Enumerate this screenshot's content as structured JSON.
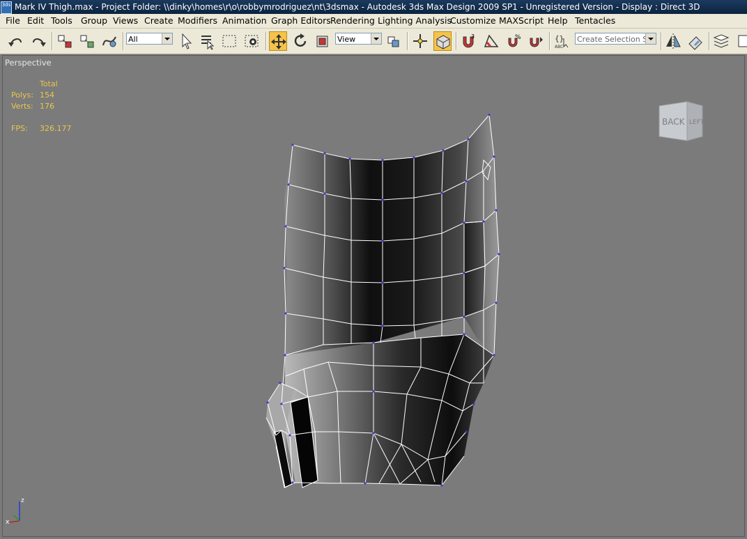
{
  "titlebar": {
    "icon_text": "3ds",
    "text": "Mark IV Thigh.max    - Project Folder: \\\\dinky\\homes\\r\\o\\robbymrodriguez\\nt\\3dsmax    - Autodesk 3ds Max Design 2009 SP1    - Unregistered Version    - Display : Direct 3D"
  },
  "menu": {
    "file": "File",
    "edit": "Edit",
    "tools": "Tools",
    "group": "Group",
    "views": "Views",
    "create": "Create",
    "modifiers": "Modifiers",
    "animation": "Animation",
    "graph_editors": "Graph Editors",
    "rendering": "Rendering",
    "lighting_analysis": "Lighting Analysis",
    "customize": "Customize",
    "maxscript": "MAXScript",
    "help": "Help",
    "tentacles": "Tentacles"
  },
  "toolbar": {
    "selection_filter": "All",
    "reference_coord": "View",
    "named_selection_placeholder": "Create Selection Set"
  },
  "viewport": {
    "label": "Perspective",
    "stats_header": "Total",
    "polys_label": "Polys:",
    "polys_value": "154",
    "verts_label": "Verts:",
    "verts_value": "176",
    "fps_label": "FPS:",
    "fps_value": "326.177"
  },
  "viewcube": {
    "face_back": "BACK",
    "face_left": "LEFT"
  },
  "axis": {
    "z": "z",
    "x": "x"
  },
  "colors": {
    "viewport_bg": "#7b7b7b",
    "stats": "#e8c84a",
    "titlebar": "#0c2340",
    "active_tool": "#f6c34a"
  }
}
